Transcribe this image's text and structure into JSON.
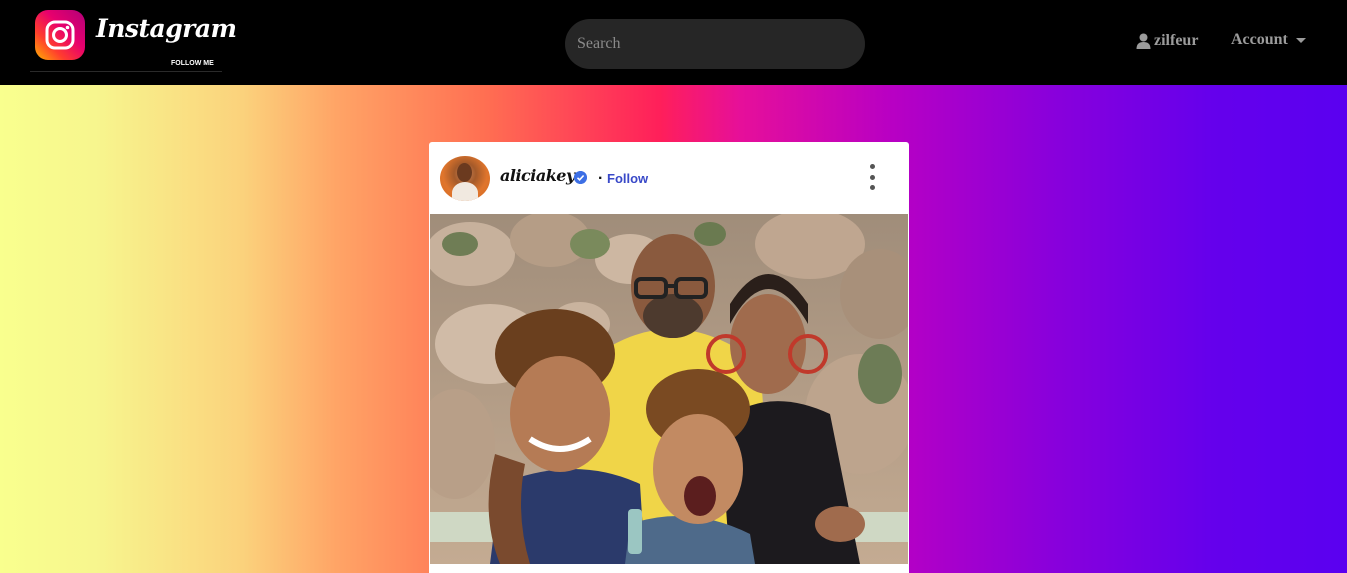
{
  "navbar": {
    "brand": {
      "name": "Instagram",
      "tagline": "FOLLOW ME",
      "icon": "instagram-camera-icon"
    },
    "search": {
      "placeholder": "Search",
      "value": ""
    },
    "user": {
      "name": "zilfeur",
      "icon": "user-icon"
    },
    "account": {
      "label": "Account",
      "icon": "caret-down-icon"
    }
  },
  "post": {
    "username": "aliciakeys",
    "verified": true,
    "separator": ".",
    "follow_label": "Follow",
    "more_icon": "more-vertical-icon",
    "photo_icon": "post-photo"
  },
  "colors": {
    "navbar_bg": "#000000",
    "search_bg": "#262626",
    "follow_blue": "#3949c8",
    "verified_blue": "#3d6fe5",
    "gradient": [
      "#f9ff8e",
      "#ffa466",
      "#ff1f5a",
      "#b900c3",
      "#5a00f0"
    ]
  }
}
